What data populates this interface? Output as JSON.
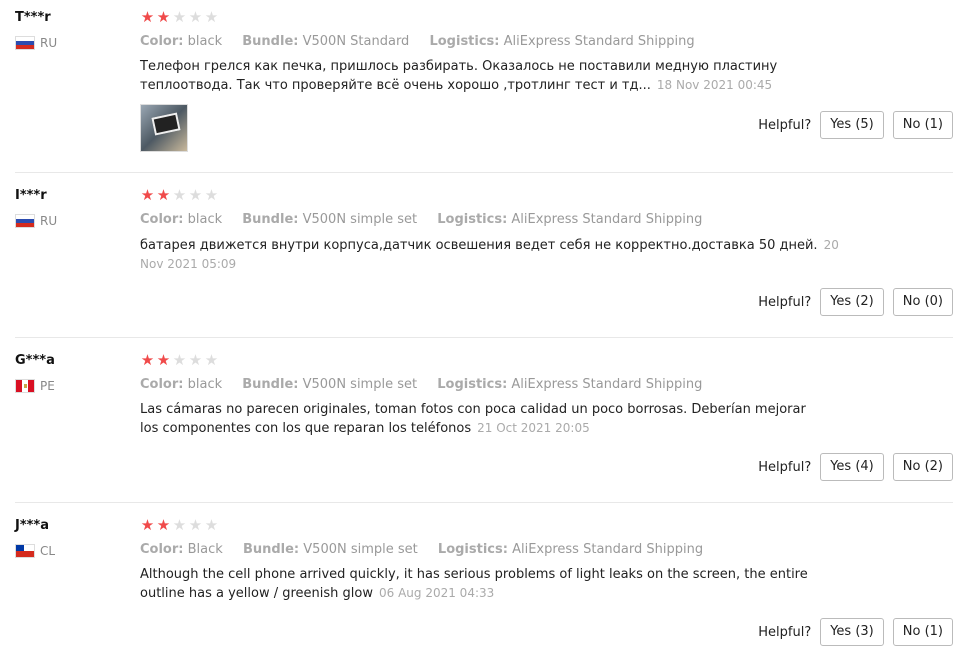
{
  "helpful_label": "Helpful?",
  "reviews": [
    {
      "user": "T***r",
      "country": "RU",
      "flag": "ru",
      "rating": 2,
      "color_key": "Color:",
      "color": "black",
      "bundle_key": "Bundle:",
      "bundle": "V500N Standard",
      "logistics_key": "Logistics:",
      "logistics": "AliExpress Standard Shipping",
      "text": "Телефон грелся как печка, пришлось разбирать. Оказалось не поставили медную пластину теплоотвода. Так что проверяйте всё очень хорошо ,тротлинг тест и тд...",
      "date": "18 Nov 2021 00:45",
      "has_photo": true,
      "yes": "Yes (5)",
      "no": "No (1)"
    },
    {
      "user": "I***r",
      "country": "RU",
      "flag": "ru",
      "rating": 2,
      "color_key": "Color:",
      "color": "black",
      "bundle_key": "Bundle:",
      "bundle": "V500N simple set",
      "logistics_key": "Logistics:",
      "logistics": "AliExpress Standard Shipping",
      "text": "батарея движется внутри корпуса,датчик освешения ведет себя не корректно.доставка 50 дней.",
      "date": "20 Nov 2021 05:09",
      "has_photo": false,
      "yes": "Yes (2)",
      "no": "No (0)"
    },
    {
      "user": "G***a",
      "country": "PE",
      "flag": "pe",
      "rating": 2,
      "color_key": "Color:",
      "color": "black",
      "bundle_key": "Bundle:",
      "bundle": "V500N simple set",
      "logistics_key": "Logistics:",
      "logistics": "AliExpress Standard Shipping",
      "text": "Las cámaras no parecen originales, toman fotos con poca calidad un poco borrosas. Deberían mejorar los componentes con los que reparan los teléfonos",
      "date": "21 Oct 2021 20:05",
      "has_photo": false,
      "yes": "Yes (4)",
      "no": "No (2)"
    },
    {
      "user": "J***a",
      "country": "CL",
      "flag": "cl",
      "rating": 2,
      "color_key": "Color:",
      "color": "Black",
      "bundle_key": "Bundle:",
      "bundle": "V500N simple set",
      "logistics_key": "Logistics:",
      "logistics": "AliExpress Standard Shipping",
      "text": "Although the cell phone arrived quickly, it has serious problems of light leaks on the screen, the entire outline has a yellow / greenish glow",
      "date": "06 Aug 2021 04:33",
      "has_photo": false,
      "yes": "Yes (3)",
      "no": "No (1)"
    }
  ]
}
